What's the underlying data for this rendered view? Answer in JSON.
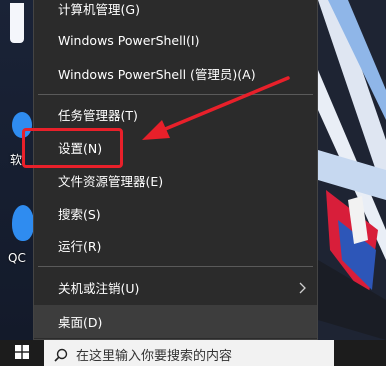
{
  "desktop": {
    "icon_label_1": "软",
    "icon_label_2": "QC"
  },
  "context_menu": {
    "items": [
      {
        "label": "计算机管理(G)"
      },
      {
        "label": "Windows PowerShell(I)"
      },
      {
        "label": "Windows PowerShell (管理员)(A)"
      },
      {
        "label": "任务管理器(T)"
      },
      {
        "label": "设置(N)"
      },
      {
        "label": "文件资源管理器(E)"
      },
      {
        "label": "搜索(S)"
      },
      {
        "label": "运行(R)"
      },
      {
        "label": "关机或注销(U)"
      },
      {
        "label": "桌面(D)"
      }
    ]
  },
  "taskbar": {
    "search_placeholder": "在这里输入你要搜索的内容"
  },
  "colors": {
    "annotation": "#e8202a",
    "menu_background": "#2b2b2b",
    "menu_hover": "#3d3d3d"
  },
  "icons": {
    "start": "windows-logo-icon",
    "search": "search-icon",
    "submenu": "chevron-right-icon"
  }
}
